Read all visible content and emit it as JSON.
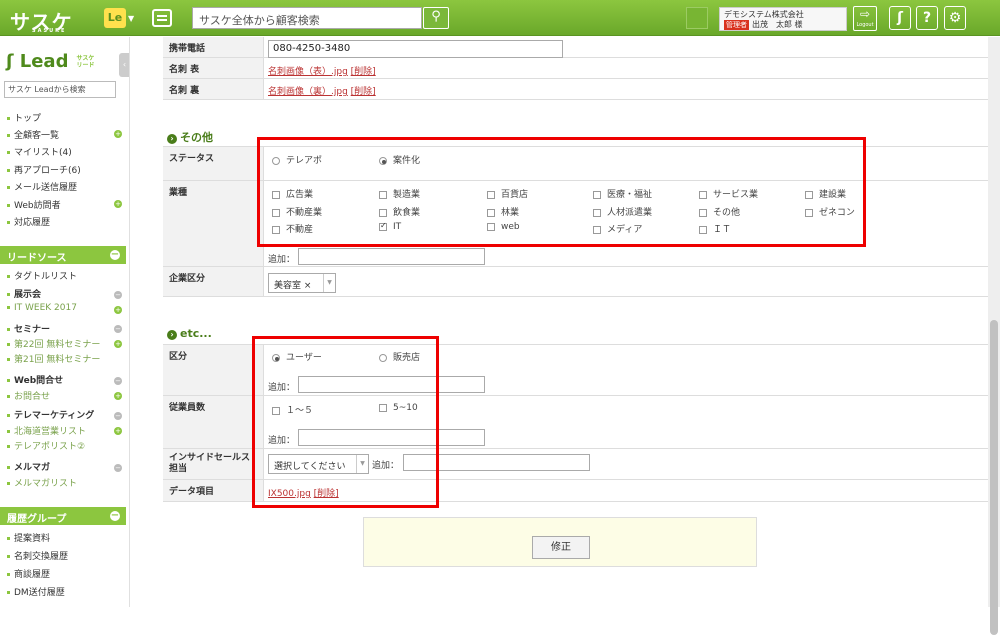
{
  "header": {
    "logo": "サスケ",
    "logo_sub": "SASUKE",
    "le_badge": "Le",
    "search_placeholder": "サスケ全体から顧客検索",
    "company": "デモシステム株式会社",
    "admin_tag": "管理者",
    "user": "出茂　太郎 様",
    "logout": "Logout"
  },
  "sidebar": {
    "brand": "Lead",
    "brand_sub1": "サスケ",
    "brand_sub2": "リード",
    "search_placeholder": "サスケ Leadから検索",
    "nav": [
      "トップ",
      "全顧客一覧",
      "マイリスト(4)",
      "再アプローチ(6)",
      "メール送信履歴",
      "Web訪問者",
      "対応履歴"
    ],
    "lead_source_head": "リードソース",
    "lead_source": {
      "tagged_list": "タグトルリスト",
      "exhibition": "展示会",
      "it_week": "IT WEEK 2017",
      "seminar": "セミナー",
      "seminar22": "第22回 無料セミナー",
      "seminar21": "第21回 無料セミナー",
      "web_inquiry": "Web問合せ",
      "inquiry": "お問合せ",
      "telemarketing": "テレマーケティング",
      "hokkaido": "北海道営業リスト",
      "tele_list": "テレアポリスト②",
      "mailmag": "メルマガ",
      "mailmag_list": "メルマガリスト"
    },
    "history_head": "履歴グループ",
    "history": [
      "提案資料",
      "名刺交換履歴",
      "商談履歴",
      "DM送付履歴"
    ]
  },
  "form": {
    "mobile_label": "携帯電話",
    "mobile_value": "080-4250-3480",
    "card_front_label": "名刺 表",
    "card_front_file": "名刺画像（表）.jpg",
    "card_back_label": "名刺 裏",
    "card_back_file": "名刺画像（裏）.jpg",
    "delete": "[削除]",
    "section_other": "その他",
    "status_label": "ステータス",
    "status_opts": [
      "テレアポ",
      "案件化"
    ],
    "industry_label": "業種",
    "industry_opts": [
      "広告業",
      "製造業",
      "百貨店",
      "医療・福祉",
      "サービス業",
      "建設業",
      "不動産業",
      "飲食業",
      "林業",
      "人材派遣業",
      "その他",
      "ゼネコン",
      "不動産",
      "IT",
      "web",
      "メディア",
      "ＩＴ"
    ],
    "add_label": "追加：",
    "company_type_label": "企業区分",
    "company_type_value": "美容室",
    "section_etc": "etc...",
    "division_label": "区分",
    "division_opts": [
      "ユーザー",
      "販売店"
    ],
    "employees_label": "従業員数",
    "employees_opts": [
      "１～５",
      "5~10"
    ],
    "inside_sales_label": "インサイドセールス担当",
    "inside_sales_select": "選択してください",
    "data_item_label": "データ項目",
    "data_item_file": "IX500.jpg",
    "edit_button": "修正"
  }
}
